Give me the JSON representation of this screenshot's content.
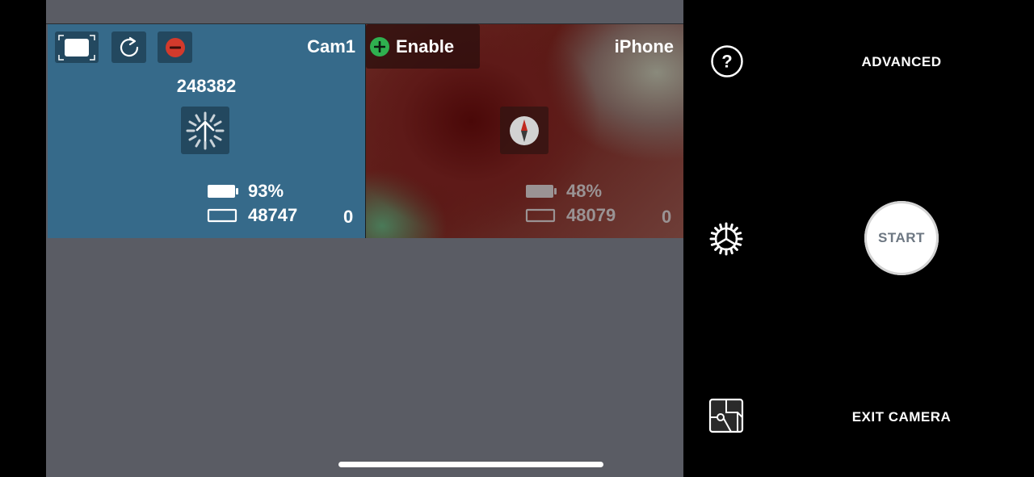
{
  "cameras": [
    {
      "name": "Cam1",
      "frame_count": "248382",
      "battery": "93%",
      "storage": "48747",
      "queue": "0"
    },
    {
      "name": "iPhone",
      "enable_label": "Enable",
      "battery": "48%",
      "storage": "48079",
      "queue": "0"
    }
  ],
  "controls": {
    "advanced_label": "ADVANCED",
    "start_label": "START",
    "exit_label": "EXIT CAMERA"
  },
  "colors": {
    "cam1_panel": "#366a8a",
    "remove_button": "#d33a2c",
    "enable_plus": "#2fb04f",
    "start_text": "#6d7782"
  },
  "icons": [
    "fullscreen-icon",
    "rotate-icon",
    "remove-icon",
    "upload-progress-icon",
    "compass-icon",
    "battery-icon",
    "storage-icon",
    "help-icon",
    "settings-gear-icon",
    "map-icon"
  ]
}
